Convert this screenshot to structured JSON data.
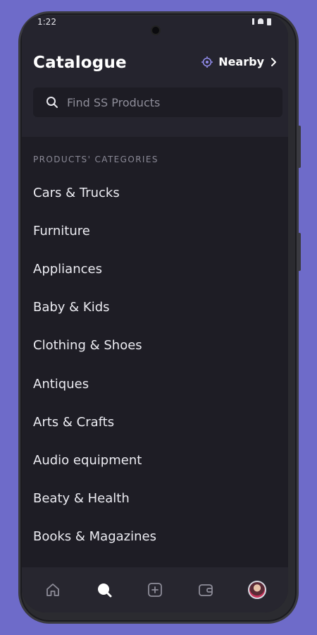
{
  "status_bar": {
    "time": "1:22"
  },
  "header": {
    "title": "Catalogue",
    "location_label": "Nearby",
    "location_icon": "crosshair-icon"
  },
  "search": {
    "placeholder": "Find SS Products",
    "value": ""
  },
  "categories": {
    "section_label": "PRODUCTS' CATEGORIES",
    "items": [
      "Cars & Trucks",
      "Furniture",
      "Appliances",
      "Baby & Kids",
      "Clothing & Shoes",
      "Antiques",
      "Arts & Crafts",
      "Audio equipment",
      "Beaty & Health",
      "Books & Magazines"
    ]
  },
  "bottom_nav": {
    "items": [
      "home-icon",
      "search-icon",
      "add-icon",
      "wallet-icon",
      "avatar"
    ],
    "active": "search-icon"
  },
  "colors": {
    "background": "#6e6bc9",
    "screen": "#1e1d25",
    "header": "#25242e",
    "accent": "#8f8ae8",
    "text": "#ececf2"
  }
}
